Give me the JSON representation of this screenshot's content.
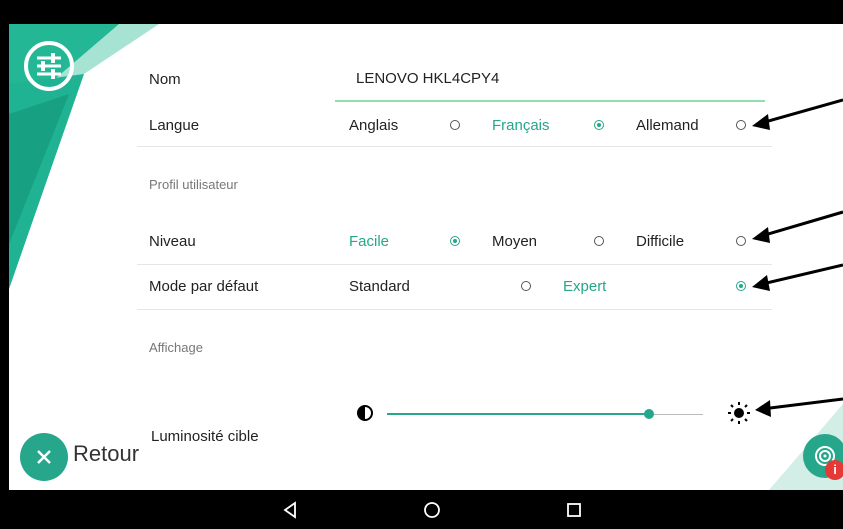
{
  "form": {
    "name": {
      "label": "Nom",
      "value": "LENOVO HKL4CPY4"
    },
    "language": {
      "label": "Langue",
      "options": [
        {
          "label": "Anglais",
          "selected": false
        },
        {
          "label": "Français",
          "selected": true
        },
        {
          "label": "Allemand",
          "selected": false
        }
      ]
    },
    "profile_section": "Profil utilisateur",
    "level": {
      "label": "Niveau",
      "options": [
        {
          "label": "Facile",
          "selected": true
        },
        {
          "label": "Moyen",
          "selected": false
        },
        {
          "label": "Difficile",
          "selected": false
        }
      ]
    },
    "default_mode": {
      "label": "Mode par défaut",
      "options": [
        {
          "label": "Standard",
          "selected": false
        },
        {
          "label": "Expert",
          "selected": true
        }
      ]
    },
    "display_section": "Affichage",
    "brightness": {
      "label": "Luminosité cible",
      "value": 0.83
    }
  },
  "footer": {
    "back_label": "Retour"
  },
  "colors": {
    "accent": "#26a68b",
    "input_underline": "#8fe0b0",
    "badge": "#e53935"
  },
  "icons": {
    "settings": "sliders-icon",
    "back": "close-icon",
    "brightness_low": "contrast-icon",
    "brightness_high": "sun-icon",
    "fab": "fingerprint-icon",
    "nav": [
      "back-triangle-icon",
      "home-circle-icon",
      "recents-square-icon"
    ]
  }
}
